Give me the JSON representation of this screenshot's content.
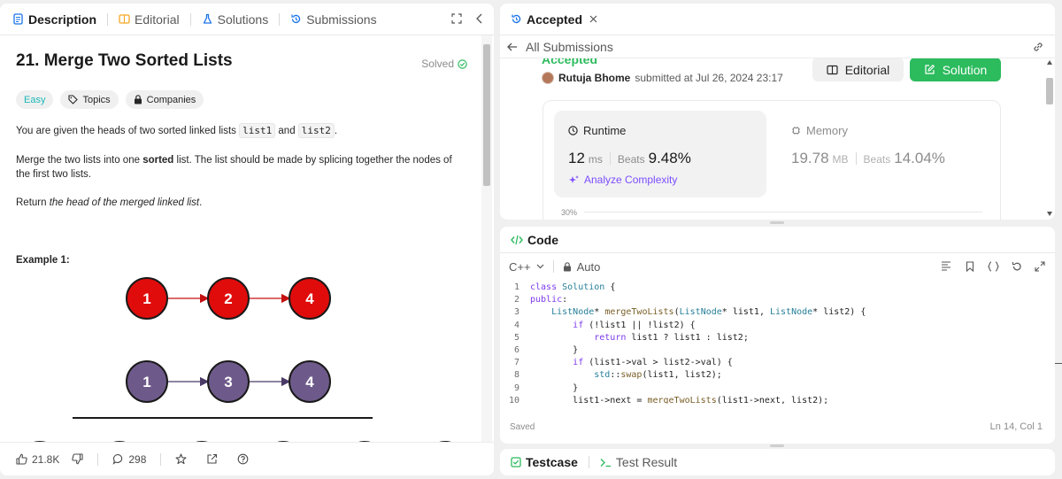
{
  "left": {
    "tabs": [
      {
        "label": "Description",
        "icon": "description-icon"
      },
      {
        "label": "Editorial",
        "icon": "editorial-icon"
      },
      {
        "label": "Solutions",
        "icon": "flask-icon"
      },
      {
        "label": "Submissions",
        "icon": "history-icon"
      }
    ],
    "title": "21. Merge Two Sorted Lists",
    "solved_label": "Solved",
    "tags": {
      "difficulty": "Easy",
      "topics": "Topics",
      "companies": "Companies"
    },
    "desc": {
      "p1_before": "You are given the heads of two sorted linked lists ",
      "p1_code1": "list1",
      "p1_and": " and ",
      "p1_code2": "list2",
      "p1_end": ".",
      "p2_before": "Merge the two lists into one ",
      "p2_bold": "sorted",
      "p2_after": " list. The list should be made by splicing together the nodes of the first two lists.",
      "p3_before": "Return ",
      "p3_italic": "the head of the merged linked list",
      "p3_end": ".",
      "example_title": "Example 1:"
    },
    "diagram": {
      "row1": [
        "1",
        "2",
        "4"
      ],
      "row2": [
        "1",
        "3",
        "4"
      ],
      "row1_color": "#e00c0c",
      "row2_color": "#6e5a8a"
    },
    "footer": {
      "likes": "21.8K",
      "comments": "298"
    }
  },
  "submission": {
    "tab_label": "Accepted",
    "back_label": "All Submissions",
    "status_partial": "Accepted",
    "user": "Rutuja Bhome",
    "submitted_text": "submitted at Jul 26, 2024 23:17",
    "editorial_btn": "Editorial",
    "solution_btn": "Solution",
    "runtime": {
      "label": "Runtime",
      "value": "12",
      "unit": "ms",
      "beats_label": "Beats",
      "beats_value": "9.48%"
    },
    "memory": {
      "label": "Memory",
      "value": "19.78",
      "unit": "MB",
      "beats_label": "Beats",
      "beats_value": "14.04%"
    },
    "analyze_label": "Analyze Complexity",
    "chart_tick": "30%"
  },
  "code": {
    "tab_label": "Code",
    "language": "C++",
    "mode": "Auto",
    "status_left": "Saved",
    "status_right": "Ln 14, Col 1"
  },
  "bottom": {
    "testcase_label": "Testcase",
    "result_label": "Test Result"
  },
  "colors": {
    "accent_green": "#2cbb5d",
    "link_blue": "#1a73e8",
    "easy_teal": "#1cb8b8",
    "purple": "#7c4dff"
  }
}
